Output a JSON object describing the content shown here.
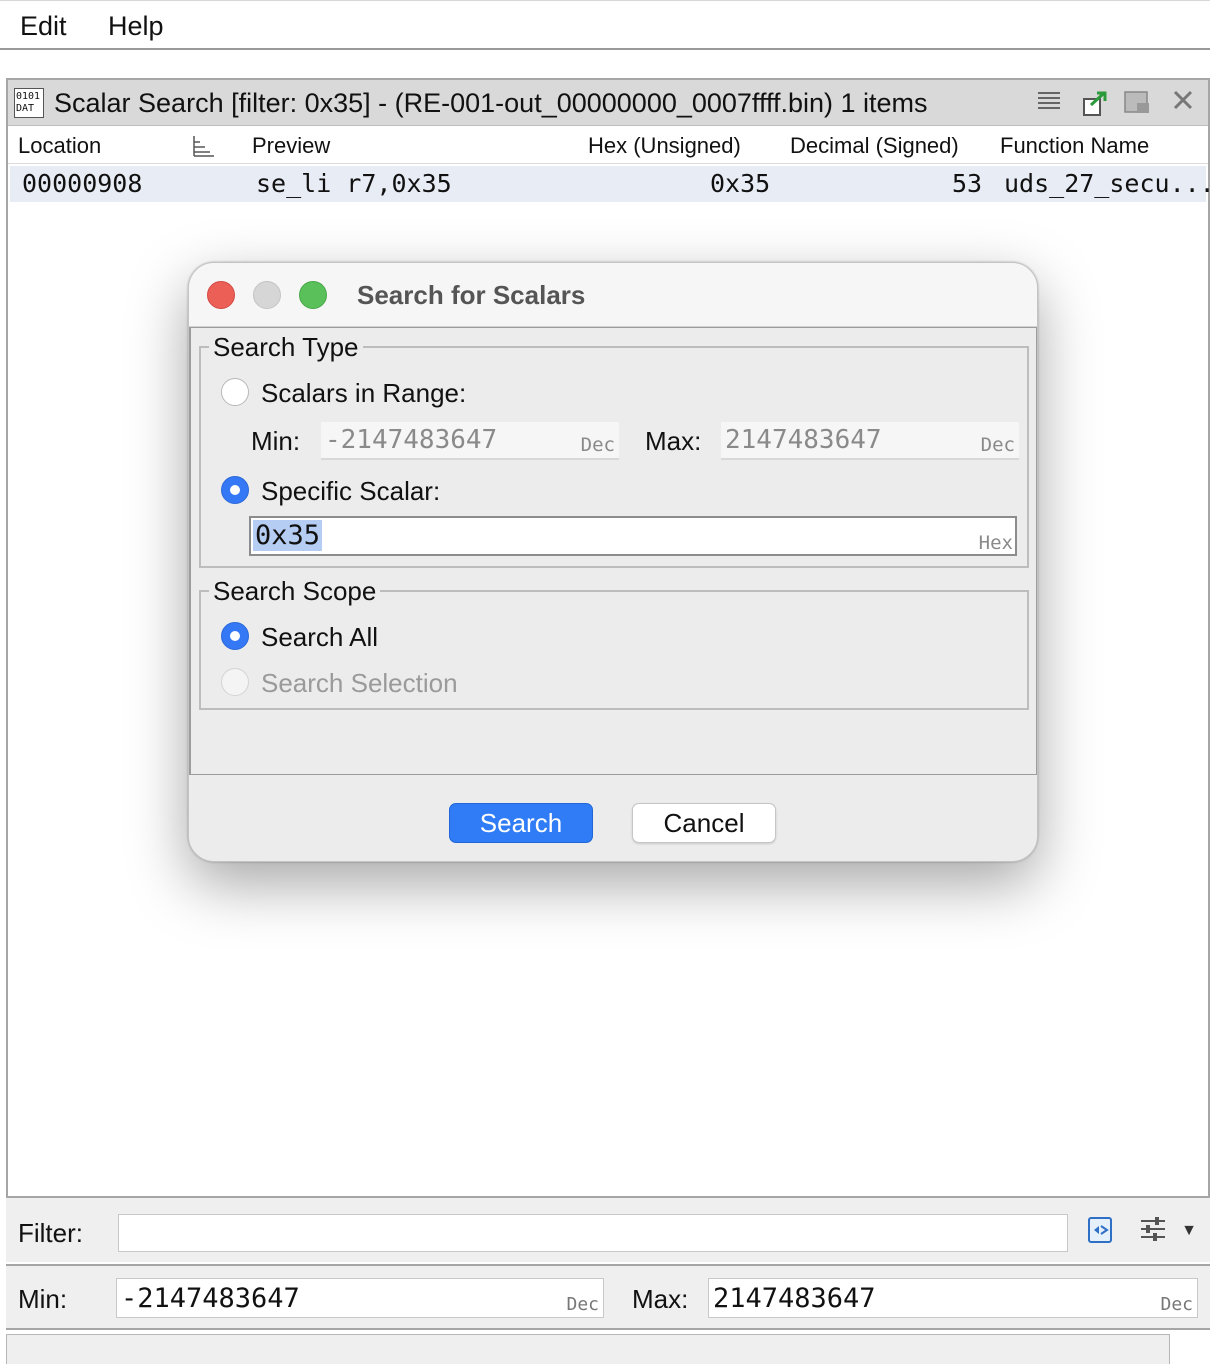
{
  "menu": {
    "edit": "Edit",
    "help": "Help"
  },
  "panel": {
    "icon_text_top": "0101",
    "icon_text_bottom": "DAT",
    "title": "Scalar Search [filter: 0x35] -  (RE-001-out_00000000_0007ffff.bin) 1 items",
    "columns": {
      "location": "Location",
      "preview": "Preview",
      "hex": "Hex (Unsigned)",
      "decimal": "Decimal (Signed)",
      "function": "Function Name"
    },
    "rows": [
      {
        "location": "00000908",
        "preview": "se_li r7,0x35",
        "hex": "0x35",
        "decimal": "53",
        "function": "uds_27_secu..."
      }
    ]
  },
  "filter": {
    "label": "Filter:",
    "value": ""
  },
  "range": {
    "min_label": "Min:",
    "min_value": "-2147483647",
    "min_format": "Dec",
    "max_label": "Max:",
    "max_value": "2147483647",
    "max_format": "Dec"
  },
  "dialog": {
    "title": "Search for Scalars",
    "search_type": {
      "legend": "Search Type",
      "range_option": "Scalars in Range:",
      "min_label": "Min:",
      "min_value": "-2147483647",
      "min_format": "Dec",
      "max_label": "Max:",
      "max_value": "2147483647",
      "max_format": "Dec",
      "specific_option": "Specific Scalar:",
      "specific_value": "0x35",
      "specific_format": "Hex",
      "selected": "specific"
    },
    "search_scope": {
      "legend": "Search Scope",
      "all_option": "Search All",
      "selection_option": "Search Selection",
      "selected": "all"
    },
    "buttons": {
      "search": "Search",
      "cancel": "Cancel"
    }
  },
  "colors": {
    "accent": "#3478f6",
    "close": "#ec5f57",
    "minimize_disabled": "#d6d6d6",
    "zoom": "#5ac05a",
    "selection_highlight": "#b5cdf3"
  }
}
